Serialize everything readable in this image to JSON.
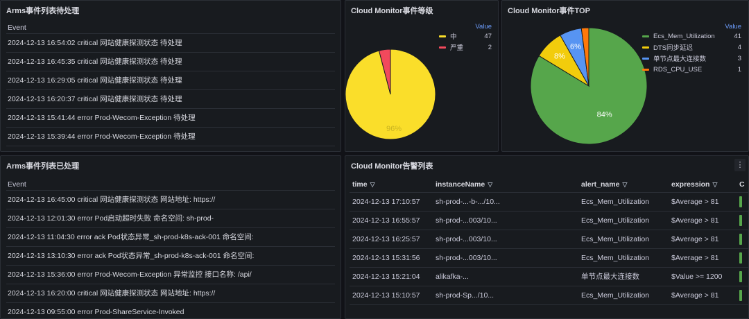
{
  "panels": {
    "pending": {
      "title": "Arms事件列表待处理",
      "column": "Event",
      "rows": [
        "2024-12-13 16:54:02 critical 网站健康探测状态 待处理",
        "2024-12-13 16:45:35 critical 网站健康探测状态 待处理",
        "2024-12-13 16:29:05 critical 网站健康探测状态 待处理",
        "2024-12-13 16:20:37 critical 网站健康探测状态 待处理",
        "2024-12-13 15:41:44 error Prod-Wecom-Exception 待处理",
        "2024-12-13 15:39:44 error Prod-Wecom-Exception 待处理"
      ]
    },
    "handled": {
      "title": "Arms事件列表已处理",
      "column": "Event",
      "rows": [
        "2024-12-13 16:45:00 critical 网站健康探测状态 网站地址: https://",
        "2024-12-13 12:01:30 error Pod启动超时失败 命名空间: sh-prod-",
        "2024-12-13 11:04:30 error ack Pod状态异常_sh-prod-k8s-ack-001 命名空间:",
        "2024-12-13 13:10:30 error ack Pod状态异常_sh-prod-k8s-ack-001 命名空间:",
        "2024-12-13 15:36:00 error Prod-Wecom-Exception 异常监控 接口名称: /api/",
        "2024-12-13 16:20:00 critical 网站健康探测状态 网站地址: https://",
        "2024-12-13 09:55:00 error Prod-ShareService-Invoked"
      ]
    },
    "level": {
      "title": "Cloud Monitor事件等级",
      "legend_header": "Value",
      "items": [
        {
          "name": "中",
          "value": 47,
          "color": "#fade2a"
        },
        {
          "name": "严重",
          "value": 2,
          "color": "#f2495c"
        }
      ],
      "slice_label": "96%"
    },
    "top": {
      "title": "Cloud Monitor事件TOP",
      "legend_header": "Value",
      "items": [
        {
          "name": "Ecs_Mem_Utilization",
          "value": 41,
          "color": "#56a64b"
        },
        {
          "name": "DTS同步延迟",
          "value": 4,
          "color": "#f2cc0c"
        },
        {
          "name": "单节点最大连接数",
          "value": 3,
          "color": "#5794f2"
        },
        {
          "name": "RDS_CPU_USE",
          "value": 1,
          "color": "#ff780a"
        }
      ],
      "slice_labels": [
        "84%",
        "8%",
        "6%"
      ]
    },
    "alerts": {
      "title": "Cloud Monitor告警列表",
      "menu_glyph": "⋮",
      "columns": [
        "time",
        "instanceName",
        "alert_name",
        "expression",
        "C"
      ],
      "rows": [
        {
          "time": "2024-12-13 17:10:57",
          "instance": "sh-prod-...-b-.../10...",
          "alert": "Ecs_Mem_Utilization",
          "expr": "$Average > 81"
        },
        {
          "time": "2024-12-13 16:55:57",
          "instance": "sh-prod-...003/10...",
          "alert": "Ecs_Mem_Utilization",
          "expr": "$Average > 81"
        },
        {
          "time": "2024-12-13 16:25:57",
          "instance": "sh-prod-...003/10...",
          "alert": "Ecs_Mem_Utilization",
          "expr": "$Average > 81"
        },
        {
          "time": "2024-12-13 15:31:56",
          "instance": "sh-prod-...003/10...",
          "alert": "Ecs_Mem_Utilization",
          "expr": "$Average > 81"
        },
        {
          "time": "2024-12-13 15:21:04",
          "instance": "alikafka-...",
          "alert": "单节点最大连接数",
          "expr": "$Value >= 1200"
        },
        {
          "time": "2024-12-13 15:10:57",
          "instance": "sh-prod-Sp.../10...",
          "alert": "Ecs_Mem_Utilization",
          "expr": "$Average > 81"
        }
      ]
    }
  }
}
